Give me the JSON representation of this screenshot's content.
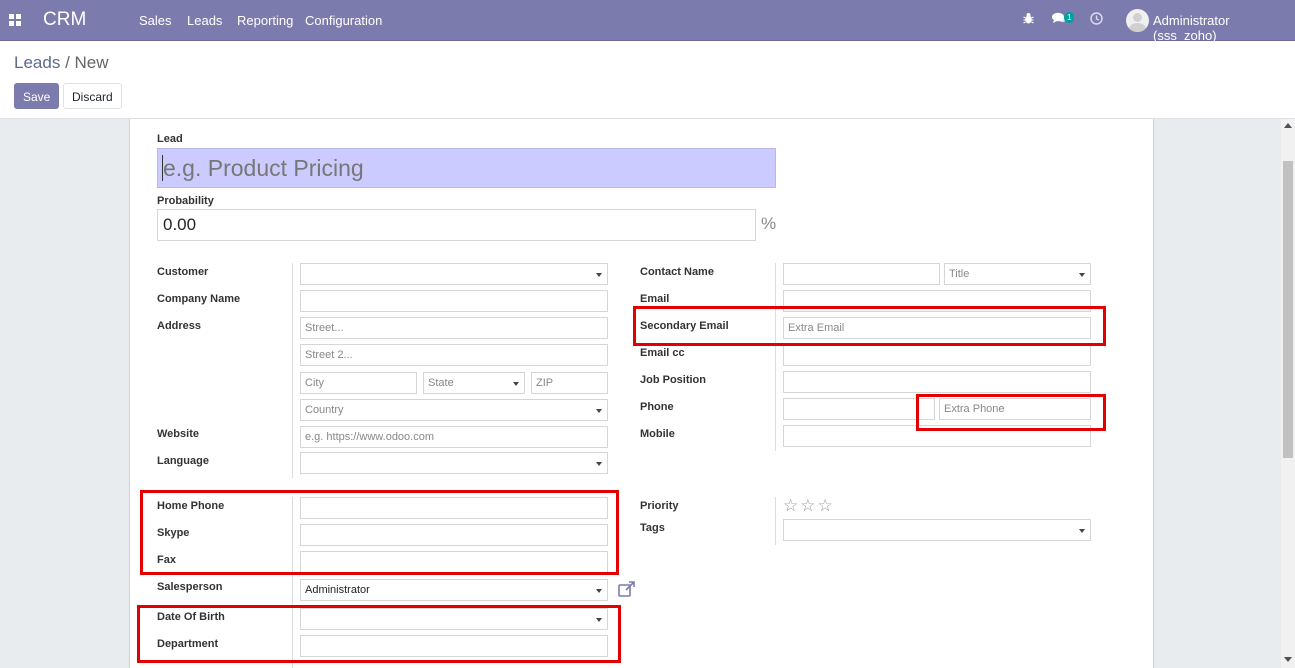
{
  "navbar": {
    "brand": "CRM",
    "menu": [
      "Sales",
      "Leads",
      "Reporting",
      "Configuration"
    ],
    "messages_badge": "1",
    "user": "Administrator (sss_zoho)"
  },
  "breadcrumb": {
    "parent": "Leads",
    "separator": "/",
    "current": "New"
  },
  "buttons": {
    "save": "Save",
    "discard": "Discard"
  },
  "form": {
    "lead_label": "Lead",
    "lead_placeholder": "e.g. Product Pricing",
    "probability_label": "Probability",
    "probability_value": "0.00",
    "probability_unit": "%",
    "left": {
      "customer": "Customer",
      "company_name": "Company Name",
      "address": "Address",
      "street_ph": "Street...",
      "street2_ph": "Street 2...",
      "city_ph": "City",
      "state_ph": "State",
      "zip_ph": "ZIP",
      "country_ph": "Country",
      "website": "Website",
      "website_ph": "e.g. https://www.odoo.com",
      "language": "Language",
      "home_phone": "Home Phone",
      "skype": "Skype",
      "fax": "Fax",
      "salesperson": "Salesperson",
      "salesperson_value": "Administrator",
      "dob": "Date Of Birth",
      "department": "Department"
    },
    "right": {
      "contact_name": "Contact Name",
      "title_ph": "Title",
      "email": "Email",
      "secondary_email": "Secondary Email",
      "extra_email_ph": "Extra Email",
      "email_cc": "Email cc",
      "job_position": "Job Position",
      "phone": "Phone",
      "extra_phone_ph": "Extra Phone",
      "mobile": "Mobile",
      "priority": "Priority",
      "priority_stars": 0,
      "priority_stars_max": 3,
      "tags": "Tags"
    }
  },
  "colors": {
    "navbar": "#7c7bad",
    "highlight_box": "#e30000",
    "lead_input": "#cbcbff"
  }
}
